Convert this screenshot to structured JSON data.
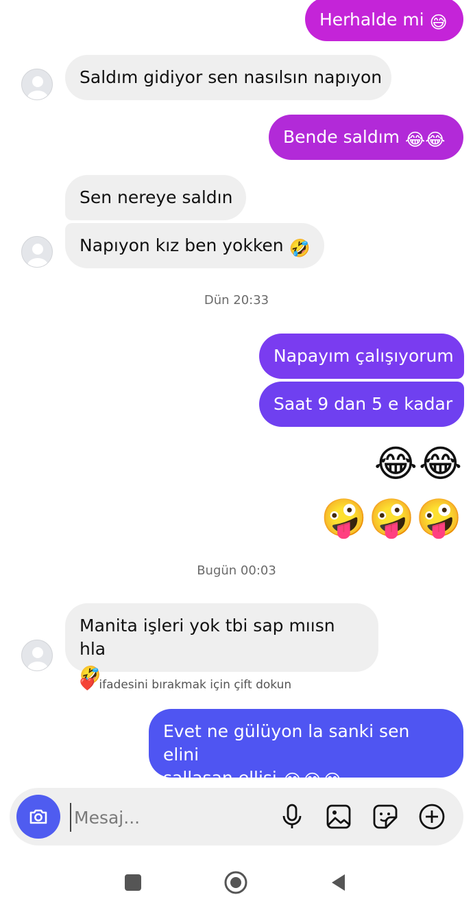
{
  "messages": [
    {
      "text": "Herhalde mi",
      "emoji": "😅",
      "color": "#c424d8"
    },
    {
      "text": "Saldım gidiyor sen nasılsın napıyon"
    },
    {
      "text": "Bende saldım",
      "emoji": "😂😂",
      "color": "#b22ad8"
    },
    {
      "text": "Sen nereye saldın"
    },
    {
      "text": "Napıyon kız ben yokken",
      "emoji": "🤣"
    },
    {
      "text": "Napayım çalışıyorum",
      "color": "#7a3cf0"
    },
    {
      "text": "Saat 9 dan 5 e kadar",
      "color": "#6f40f0"
    },
    {
      "text": "Manita işleri yok tbi sap mıısn hla",
      "emoji": "🤣"
    },
    {
      "line1": "Evet ne gülüyon la sanki sen elini",
      "line2": "sallasan ellisi",
      "emoji": "😂😂😂",
      "color": "#4f55f2"
    }
  ],
  "timestamps": {
    "yesterday": "Dün 20:33",
    "today": "Bugün 00:03"
  },
  "big_emojis": {
    "row1": "😂😂",
    "row2": "🤪🤪🤪"
  },
  "hint": {
    "heart": "❤️",
    "text": "ifadesini bırakmak için çift dokun"
  },
  "composer": {
    "placeholder": "Mesaj..."
  },
  "icons": [
    "camera-icon",
    "microphone-icon",
    "gallery-icon",
    "sticker-icon",
    "plus-icon",
    "nav-recents-icon",
    "nav-home-icon",
    "nav-back-icon"
  ]
}
